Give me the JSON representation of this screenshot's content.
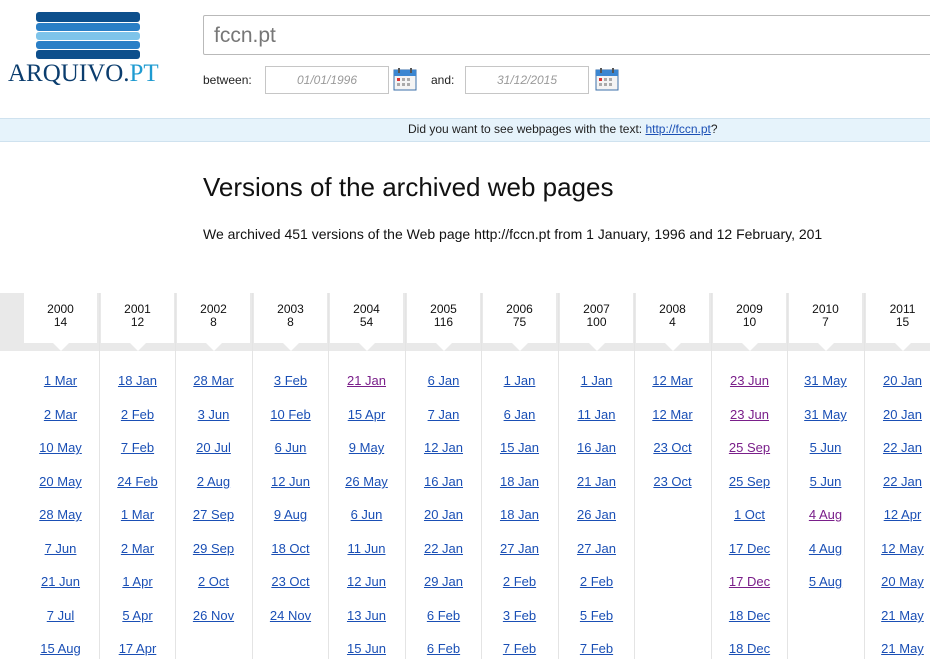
{
  "logo": {
    "text_main": "ARQUIVO.",
    "text_accent": "PT"
  },
  "search": {
    "value": "fccn.pt"
  },
  "dates": {
    "between_label": "between:",
    "from_value": "01/01/1996",
    "and_label": "and:",
    "to_value": "31/12/2015"
  },
  "suggestion": {
    "prefix": "Did you want to see webpages with the text: ",
    "link": "http://fccn.pt",
    "suffix": "?"
  },
  "page_title": "Versions of the archived web pages",
  "description": "We archived 451 versions of the Web page http://fccn.pt from 1 January, 1996 and 12 February, 201",
  "colors": {
    "link": "#1a4fb5",
    "visited": "#7a1f8a",
    "suggest_bg": "#e6f3fb",
    "logo_blue": "#0b3d6e",
    "logo_accent": "#1f9bd1"
  },
  "years": [
    {
      "year": "2000",
      "count": "14",
      "dates": [
        "1 Mar",
        "2 Mar",
        "10 May",
        "20 May",
        "28 May",
        "7 Jun",
        "21 Jun",
        "7 Jul",
        "15 Aug"
      ],
      "visited": []
    },
    {
      "year": "2001",
      "count": "12",
      "dates": [
        "18 Jan",
        "2 Feb",
        "7 Feb",
        "24 Feb",
        "1 Mar",
        "2 Mar",
        "1 Apr",
        "5 Apr",
        "17 Apr"
      ],
      "visited": []
    },
    {
      "year": "2002",
      "count": "8",
      "dates": [
        "28 Mar",
        "3 Jun",
        "20 Jul",
        "2 Aug",
        "27 Sep",
        "29 Sep",
        "2 Oct",
        "26 Nov"
      ],
      "visited": []
    },
    {
      "year": "2003",
      "count": "8",
      "dates": [
        "3 Feb",
        "10 Feb",
        "6 Jun",
        "12 Jun",
        "9 Aug",
        "18 Oct",
        "23 Oct",
        "24 Nov"
      ],
      "visited": []
    },
    {
      "year": "2004",
      "count": "54",
      "dates": [
        "21 Jan",
        "15 Apr",
        "9 May",
        "26 May",
        "6 Jun",
        "11 Jun",
        "12 Jun",
        "13 Jun",
        "15 Jun"
      ],
      "visited": [
        0
      ]
    },
    {
      "year": "2005",
      "count": "116",
      "dates": [
        "6 Jan",
        "7 Jan",
        "12 Jan",
        "16 Jan",
        "20 Jan",
        "22 Jan",
        "29 Jan",
        "6 Feb",
        "6 Feb"
      ],
      "visited": []
    },
    {
      "year": "2006",
      "count": "75",
      "dates": [
        "1 Jan",
        "6 Jan",
        "15 Jan",
        "18 Jan",
        "18 Jan",
        "27 Jan",
        "2 Feb",
        "3 Feb",
        "7 Feb"
      ],
      "visited": []
    },
    {
      "year": "2007",
      "count": "100",
      "dates": [
        "1 Jan",
        "11 Jan",
        "16 Jan",
        "21 Jan",
        "26 Jan",
        "27 Jan",
        "2 Feb",
        "5 Feb",
        "7 Feb"
      ],
      "visited": []
    },
    {
      "year": "2008",
      "count": "4",
      "dates": [
        "12 Mar",
        "12 Mar",
        "23 Oct",
        "23 Oct"
      ],
      "visited": []
    },
    {
      "year": "2009",
      "count": "10",
      "dates": [
        "23 Jun",
        "23 Jun",
        "25 Sep",
        "25 Sep",
        "1 Oct",
        "17 Dec",
        "17 Dec",
        "18 Dec",
        "18 Dec"
      ],
      "visited": [
        0,
        1,
        2,
        6
      ]
    },
    {
      "year": "2010",
      "count": "7",
      "dates": [
        "31 May",
        "31 May",
        "5 Jun",
        "5 Jun",
        "4 Aug",
        "4 Aug",
        "5 Aug"
      ],
      "visited": [
        4
      ]
    },
    {
      "year": "2011",
      "count": "15",
      "dates": [
        "20 Jan",
        "20 Jan",
        "22 Jan",
        "22 Jan",
        "12 Apr",
        "12 May",
        "20 May",
        "21 May",
        "21 May"
      ],
      "visited": []
    }
  ]
}
